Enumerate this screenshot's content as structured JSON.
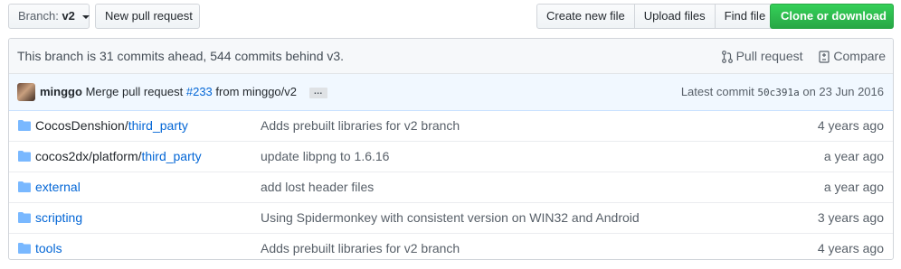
{
  "toolbar": {
    "branch_prefix": "Branch:",
    "branch_value": "v2",
    "new_pr": "New pull request",
    "create_file": "Create new file",
    "upload_files": "Upload files",
    "find_file": "Find file",
    "clone": "Clone or download"
  },
  "branch_info": {
    "text": "This branch is 31 commits ahead, 544 commits behind v3.",
    "pull_request": "Pull request",
    "compare": "Compare"
  },
  "commit": {
    "author": "minggo",
    "message_pre": "Merge pull request",
    "pr_link": "#233",
    "message_post": "from minggo/v2",
    "ellipsis": "…",
    "latest_label": "Latest commit",
    "sha": "50c391a",
    "date": "on 23 Jun 2016"
  },
  "files": [
    {
      "dir": "CocosDenshion/",
      "name": "third_party",
      "message": "Adds prebuilt libraries for v2 branch",
      "age": "4 years ago"
    },
    {
      "dir": "cocos2dx/platform/",
      "name": "third_party",
      "message": "update libpng to 1.6.16",
      "age": "a year ago"
    },
    {
      "dir": "",
      "name": "external",
      "message": "add lost header files",
      "age": "a year ago"
    },
    {
      "dir": "",
      "name": "scripting",
      "message": "Using Spidermonkey with consistent version on WIN32 and Android",
      "age": "3 years ago"
    },
    {
      "dir": "",
      "name": "tools",
      "message": "Adds prebuilt libraries for v2 branch",
      "age": "4 years ago"
    }
  ],
  "colors": {
    "link": "#0366d6",
    "clone_green": "#28a745",
    "folder": "#79b8ff"
  },
  "icons": [
    "folder-icon",
    "pull-request-icon",
    "compare-icon",
    "caret-down-icon"
  ]
}
